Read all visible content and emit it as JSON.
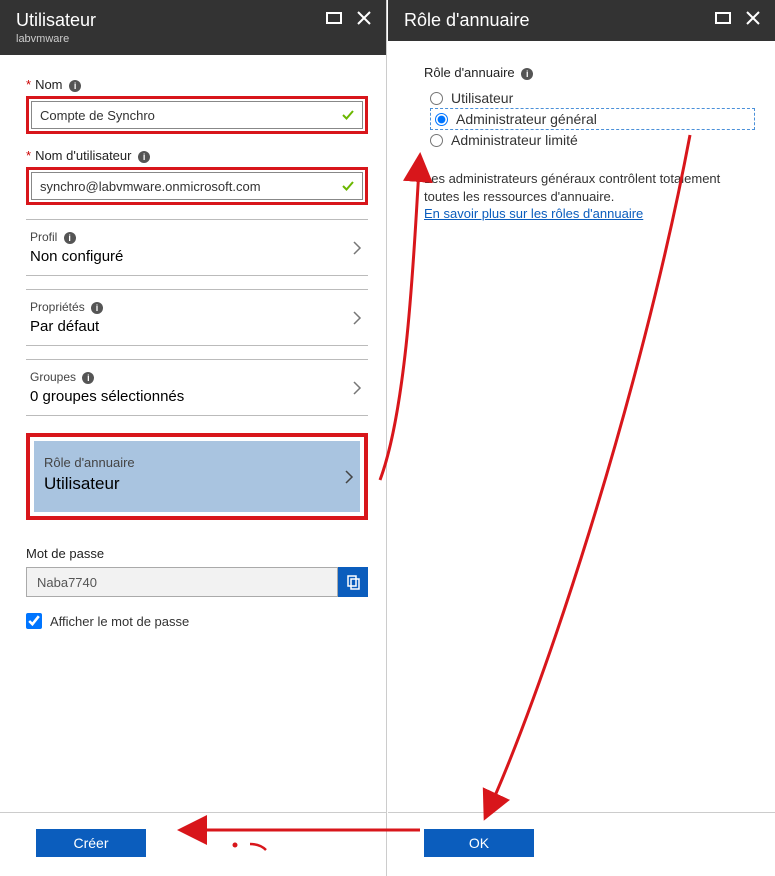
{
  "panes": {
    "left": {
      "title": "Utilisateur",
      "subtitle": "labvmware",
      "fields": {
        "name_label": "Nom",
        "name_value": "Compte de Synchro",
        "username_label": "Nom d'utilisateur",
        "username_value": "synchro@labvmware.onmicrosoft.com"
      },
      "items": {
        "profil_label": "Profil",
        "profil_value": "Non configuré",
        "props_label": "Propriétés",
        "props_value": "Par défaut",
        "groups_label": "Groupes",
        "groups_value": "0 groupes sélectionnés",
        "role_label": "Rôle d'annuaire",
        "role_value": "Utilisateur"
      },
      "password": {
        "label": "Mot de passe",
        "value": "Naba7740",
        "show_label": "Afficher le mot de passe"
      },
      "create_btn": "Créer"
    },
    "right": {
      "title": "Rôle d'annuaire",
      "section_label": "Rôle d'annuaire",
      "options": {
        "user": "Utilisateur",
        "global_admin": "Administrateur général",
        "limited_admin": "Administrateur limité"
      },
      "desc1": "Les administrateurs généraux contrôlent totalement toutes les ressources d'annuaire.",
      "link": "En savoir plus sur les rôles d'annuaire",
      "ok_btn": "OK"
    }
  }
}
